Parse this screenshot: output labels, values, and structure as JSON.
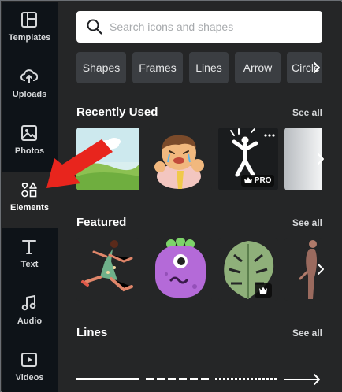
{
  "sidebar": {
    "items": [
      {
        "label": "Templates",
        "icon": "templates-icon"
      },
      {
        "label": "Uploads",
        "icon": "cloud-upload-icon"
      },
      {
        "label": "Photos",
        "icon": "photo-icon"
      },
      {
        "label": "Elements",
        "icon": "shapes-icon",
        "active": true
      },
      {
        "label": "Text",
        "icon": "text-icon"
      },
      {
        "label": "Audio",
        "icon": "music-note-icon"
      },
      {
        "label": "Videos",
        "icon": "video-icon"
      }
    ]
  },
  "search": {
    "placeholder": "Search icons and shapes",
    "value": ""
  },
  "chips": [
    "Shapes",
    "Frames",
    "Lines",
    "Arrow",
    "Circle"
  ],
  "sections": {
    "recently_used": {
      "title": "Recently Used",
      "see_all": "See all",
      "badge": "PRO"
    },
    "featured": {
      "title": "Featured",
      "see_all": "See all"
    },
    "lines": {
      "title": "Lines",
      "see_all": "See all"
    }
  },
  "colors": {
    "rail_bg": "#0e1318",
    "panel_bg": "#252627",
    "chip_bg": "#3b3e42",
    "annotation_arrow": "#e8251d"
  }
}
